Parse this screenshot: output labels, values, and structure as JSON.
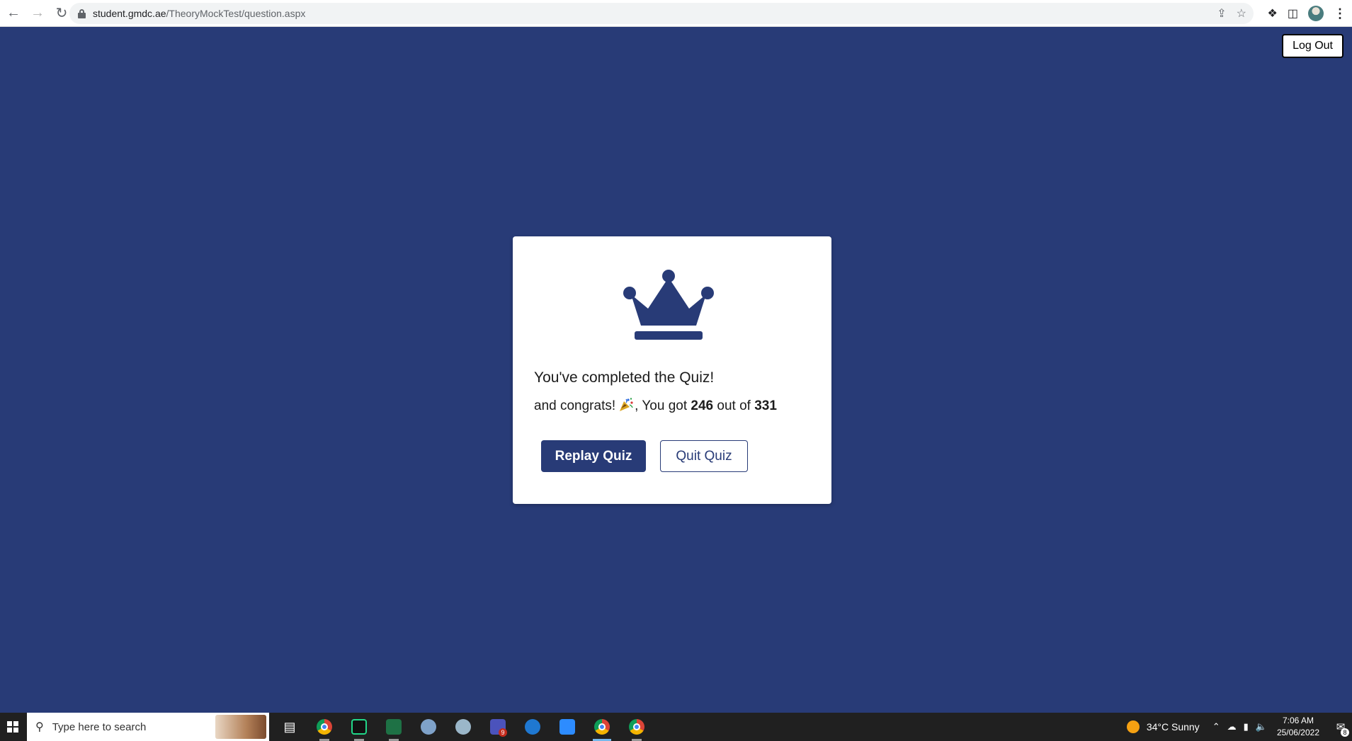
{
  "browser": {
    "url_host": "student.gmdc.ae",
    "url_path": "/TheoryMockTest/question.aspx"
  },
  "header": {
    "logout_label": "Log Out"
  },
  "result": {
    "title": "You've completed the Quiz!",
    "message_prefix": "and congrats!",
    "message_mid": ", You got",
    "score": "246",
    "out_of_label": "out of",
    "total": "331",
    "replay_label": "Replay Quiz",
    "quit_label": "Quit Quiz",
    "icon": "crown-icon"
  },
  "taskbar": {
    "search_placeholder": "Type here to search",
    "teams_badge": "9",
    "weather": "34°C  Sunny",
    "time": "7:06 AM",
    "date": "25/06/2022",
    "notification_count": "8"
  },
  "colors": {
    "page_background": "#283b77",
    "primary": "#283b77",
    "card": "#ffffff",
    "taskbar": "#202020"
  }
}
